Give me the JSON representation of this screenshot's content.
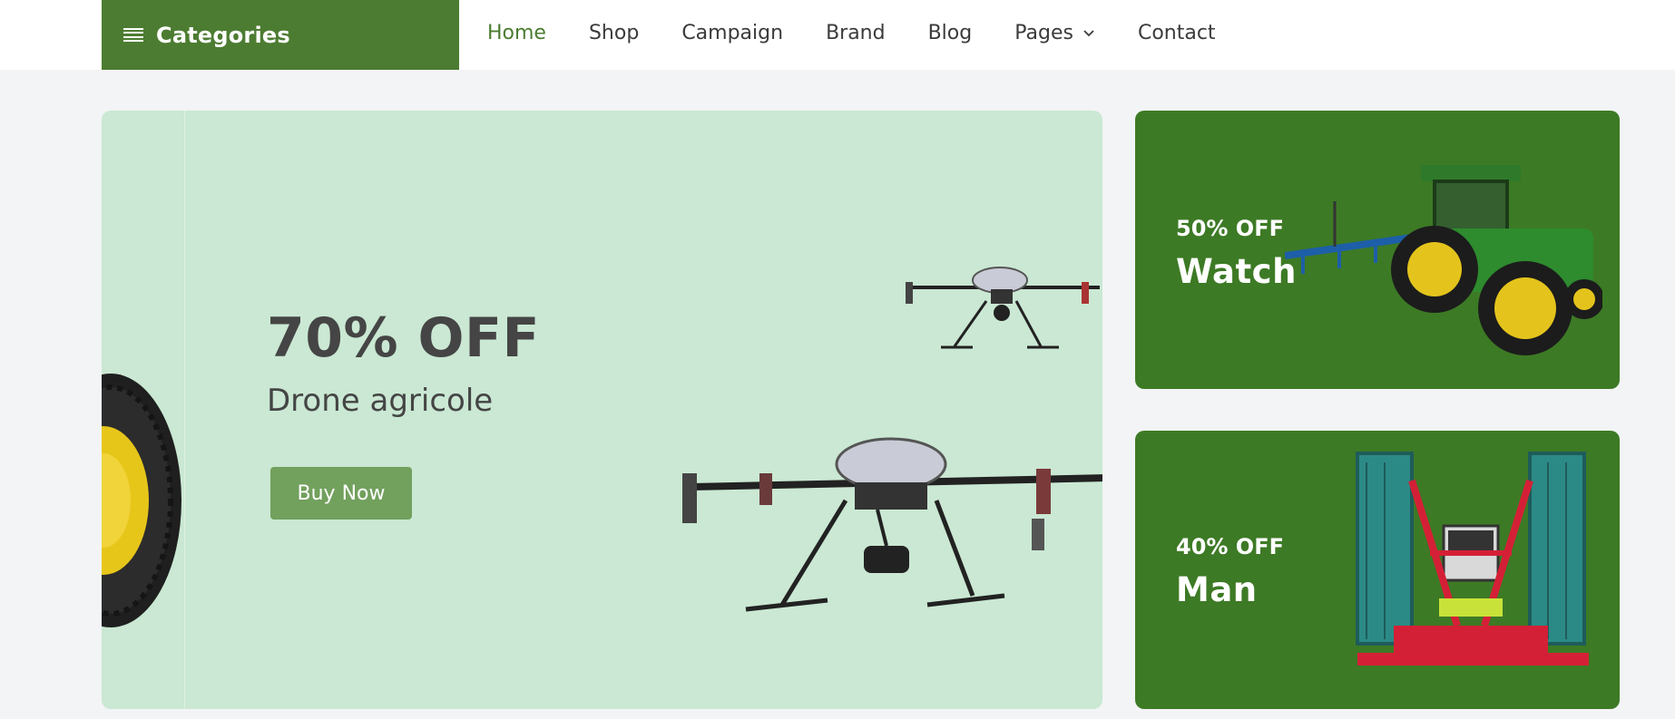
{
  "header": {
    "categories_label": "Categories",
    "nav": [
      {
        "label": "Home",
        "active": true
      },
      {
        "label": "Shop"
      },
      {
        "label": "Campaign"
      },
      {
        "label": "Brand"
      },
      {
        "label": "Blog"
      },
      {
        "label": "Pages",
        "has_dropdown": true
      },
      {
        "label": "Contact"
      }
    ]
  },
  "hero": {
    "discount": "70% OFF",
    "subtitle": "Drone agricole",
    "button_label": "Buy Now"
  },
  "promos": [
    {
      "discount": "50% OFF",
      "title": "Watch"
    },
    {
      "discount": "40% OFF",
      "title": "Man"
    }
  ],
  "colors": {
    "brand_green": "#4c7c31",
    "promo_green": "#3d7a25",
    "hero_bg": "#cae8d3",
    "button_green": "#72a05d",
    "page_bg": "#f2f4f5"
  },
  "icons": [
    "menu-icon",
    "chevron-down-icon"
  ]
}
